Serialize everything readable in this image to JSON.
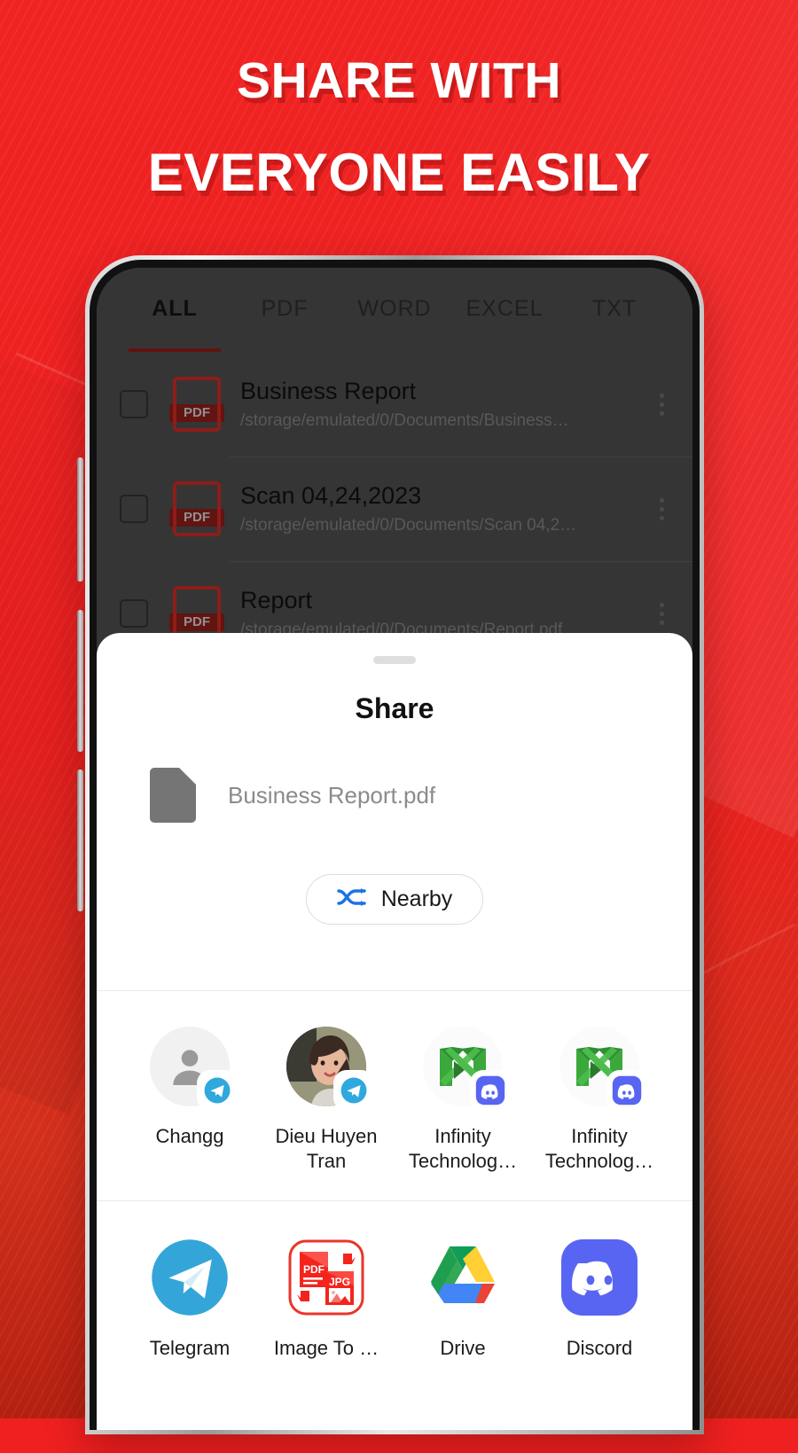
{
  "headline": {
    "line1": "SHARE WITH",
    "line2": "EVERYONE EASILY"
  },
  "colors": {
    "background_red": "#ef2020",
    "background_red_dark": "#b42010",
    "accent_underline": "#8d1c18",
    "pdf_red": "#8d1d19",
    "telegram_blue": "#2fa8dd",
    "discord_blurple": "#5865f2",
    "nearby_icon_blue": "#1a73e8"
  },
  "app": {
    "tabs": [
      {
        "label": "ALL",
        "active": true
      },
      {
        "label": "PDF",
        "active": false
      },
      {
        "label": "WORD",
        "active": false
      },
      {
        "label": "EXCEL",
        "active": false
      },
      {
        "label": "TXT",
        "active": false
      }
    ],
    "files": [
      {
        "title": "Business Report",
        "path": "/storage/emulated/0/Documents/Business…",
        "type": "PDF",
        "checked": false
      },
      {
        "title": "Scan 04,24,2023",
        "path": "/storage/emulated/0/Documents/Scan 04,2…",
        "type": "PDF",
        "checked": false
      },
      {
        "title": "Report",
        "path": "/storage/emulated/0/Documents/Report.pdf",
        "type": "PDF",
        "checked": false
      }
    ]
  },
  "share_sheet": {
    "title": "Share",
    "file": {
      "name": "Business Report.pdf",
      "icon": "document-icon"
    },
    "nearby": {
      "label": "Nearby",
      "icon": "nearby-share-icon"
    },
    "contacts": [
      {
        "name": "Changg",
        "avatar": "person-placeholder",
        "badge": "telegram-icon"
      },
      {
        "name": "Dieu Huyen Tran",
        "avatar": "photo-portrait",
        "badge": "telegram-icon"
      },
      {
        "name": "Infinity Technolog…",
        "avatar": "infinity-m-logo",
        "badge": "discord-icon"
      },
      {
        "name": "Infinity Technolog…",
        "avatar": "infinity-m-logo",
        "badge": "discord-icon"
      }
    ],
    "apps": [
      {
        "name": "Telegram",
        "icon": "telegram-icon"
      },
      {
        "name": "Image To …",
        "icon": "image-to-pdf-icon"
      },
      {
        "name": "Drive",
        "icon": "google-drive-icon"
      },
      {
        "name": "Discord",
        "icon": "discord-icon"
      }
    ]
  }
}
